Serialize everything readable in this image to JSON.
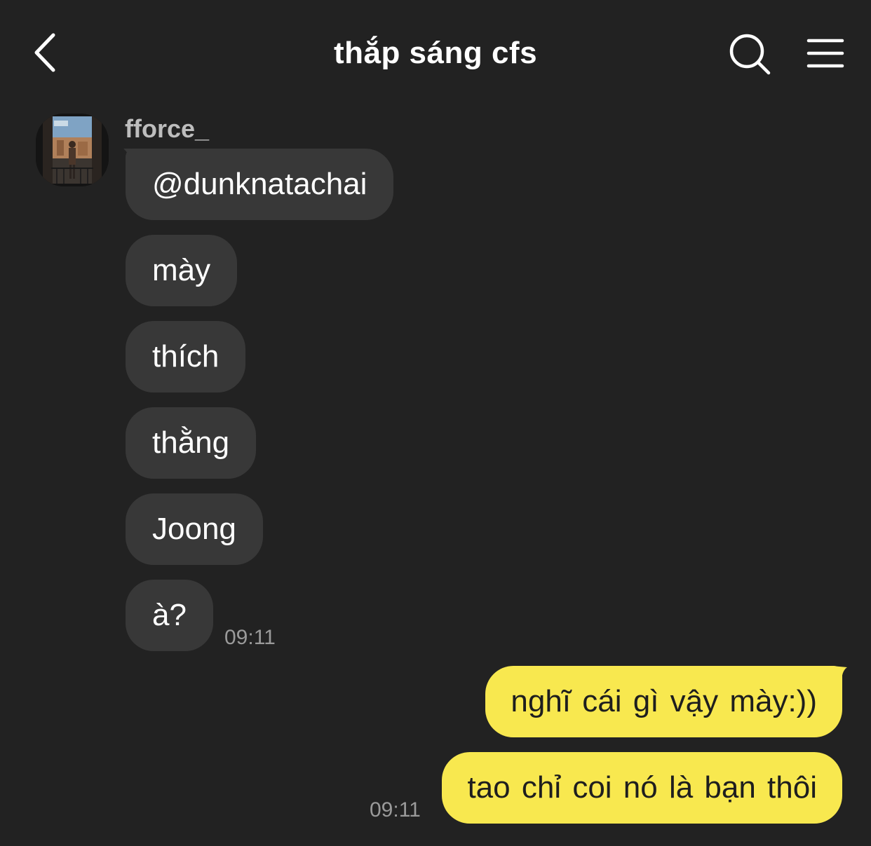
{
  "header": {
    "title": "thắp sáng cfs",
    "back_icon": "chevron-left-icon",
    "search_icon": "search-icon",
    "menu_icon": "hamburger-menu-icon"
  },
  "incoming": {
    "sender": "fforce_",
    "messages": [
      "@dunknatachai",
      "mày",
      "thích",
      "thằng",
      "Joong",
      "à?"
    ],
    "time": "09:11"
  },
  "outgoing": {
    "messages": [
      "nghĩ cái gì vậy mày:))",
      "tao chỉ coi nó là bạn thôi"
    ],
    "time": "09:11"
  },
  "colors": {
    "background": "#222222",
    "incoming_bubble": "#383838",
    "outgoing_bubble": "#f8e84f",
    "timestamp": "#9a9a9a"
  }
}
